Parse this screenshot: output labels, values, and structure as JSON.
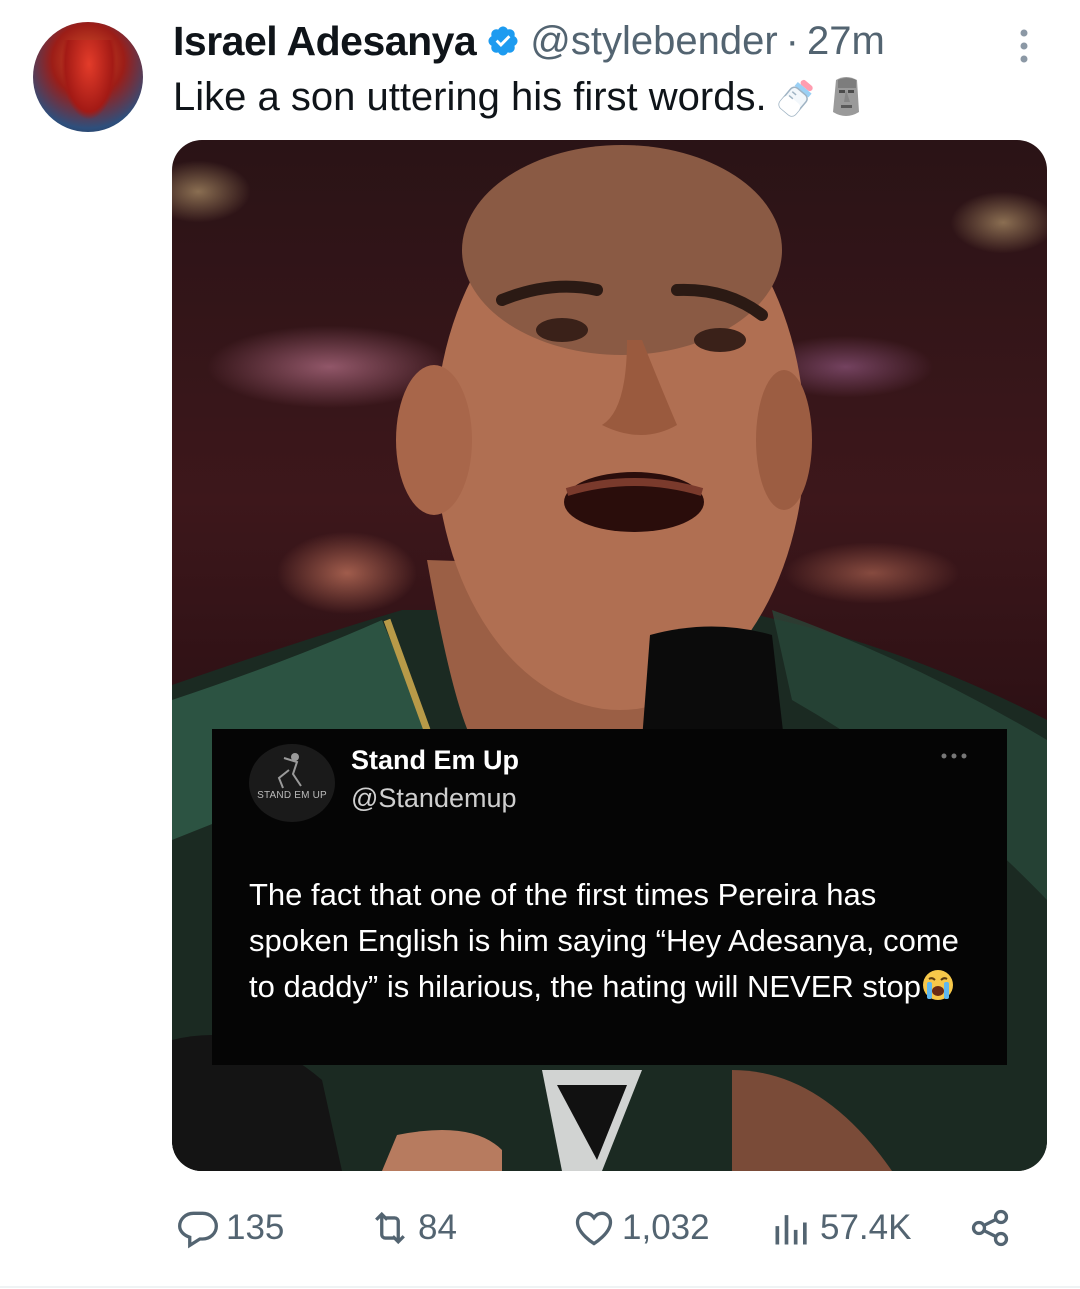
{
  "author": {
    "display_name": "Israel Adesanya",
    "handle": "@stylebender",
    "separator": "·",
    "timestamp": "27m",
    "verified_icon": "verified-badge",
    "avatar_icon": "avatar"
  },
  "tweet": {
    "text": "Like a son uttering his first words.",
    "emojis": [
      "baby-bottle-emoji",
      "moai-emoji"
    ]
  },
  "media": {
    "embedded_post": {
      "avatar_text": "STAND EM UP",
      "name": "Stand Em Up",
      "handle": "@Standemup",
      "body": "The fact that one of the first times Pereira has spoken English is him saying “Hey Adesanya, come to daddy” is hilarious, the hating will NEVER stop",
      "trailing_emoji": "loudly-crying-emoji"
    }
  },
  "actions": {
    "replies": "135",
    "reposts": "84",
    "likes": "1,032",
    "views": "57.4K"
  },
  "colors": {
    "text_primary": "#0f1419",
    "text_secondary": "#536471",
    "verified": "#1d9bf0"
  }
}
